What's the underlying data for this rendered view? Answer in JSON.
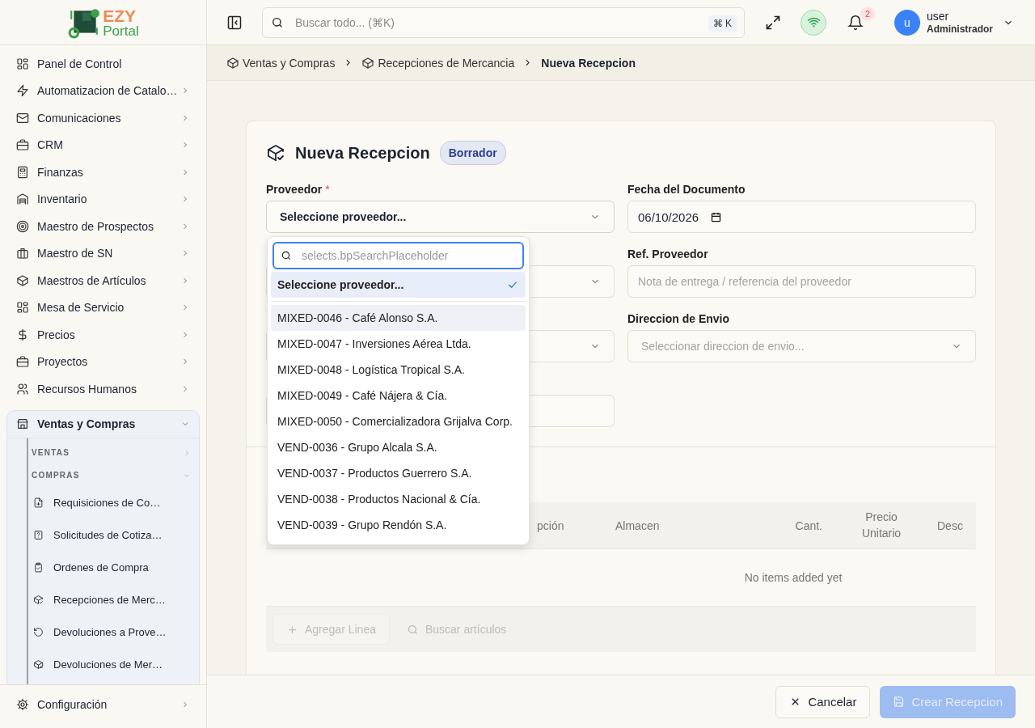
{
  "sidebar": {
    "logo": {
      "line_1": "EZY",
      "line_2": "Portal"
    },
    "items": [
      {
        "label": "Panel de Control",
        "expandable": false
      },
      {
        "label": "Automatizacion de Catalo…",
        "expandable": true,
        "expanded": false
      },
      {
        "label": "Comunicaciones",
        "expandable": true,
        "expanded": false
      },
      {
        "label": "CRM",
        "expandable": true,
        "expanded": false
      },
      {
        "label": "Finanzas",
        "expandable": true,
        "expanded": false
      },
      {
        "label": "Inventario",
        "expandable": true,
        "expanded": false
      },
      {
        "label": "Maestro de Prospectos",
        "expandable": true,
        "expanded": false
      },
      {
        "label": "Maestro de SN",
        "expandable": true,
        "expanded": false
      },
      {
        "label": "Maestros de Artículos",
        "expandable": true,
        "expanded": false
      },
      {
        "label": "Mesa de Servicio",
        "expandable": true,
        "expanded": false
      },
      {
        "label": "Precios",
        "expandable": true,
        "expanded": false
      },
      {
        "label": "Proyectos",
        "expandable": true,
        "expanded": false
      },
      {
        "label": "Recursos Humanos",
        "expandable": true,
        "expanded": false
      },
      {
        "label": "Ventas y Compras",
        "expandable": true,
        "expanded": true,
        "children": [
          {
            "label": "VENTAS",
            "expanded": false
          },
          {
            "label": "COMPRAS",
            "expanded": true,
            "children": [
              {
                "label": "Requisiciones de Co…"
              },
              {
                "label": "Solicitudes de Cotiza…"
              },
              {
                "label": "Ordenes de Compra"
              },
              {
                "label": "Recepciones de Merc…"
              },
              {
                "label": "Devoluciones a Prove…"
              },
              {
                "label": "Devoluciones de Mer…"
              }
            ]
          }
        ]
      }
    ],
    "footer_item": {
      "label": "Configuración"
    }
  },
  "header": {
    "search": {
      "placeholder": "Buscar todo... (⌘K)",
      "shortcut": "⌘ K"
    },
    "notifications": {
      "count": "2"
    },
    "user": {
      "avatar_letter": "u",
      "name": "user",
      "role": "Administrador"
    }
  },
  "breadcrumbs": [
    {
      "label": "Ventas y Compras",
      "current": false
    },
    {
      "label": "Recepciones de Mercancia",
      "current": false
    },
    {
      "label": "Nueva Recepcion",
      "current": true
    }
  ],
  "form": {
    "title": "Nueva Recepcion",
    "status": "Borrador",
    "fields": [
      {
        "kind": "select",
        "label": "Proveedor",
        "required_mark": "*",
        "value": "Seleccione proveedor...",
        "dropdown": {
          "search_placeholder": "selects.bpSearchPlaceholder",
          "options": [
            {
              "kind": "placeholder",
              "label": "Seleccione proveedor...",
              "selected": true,
              "highlighted": false
            },
            {
              "kind": "vendor",
              "label": "MIXED-0046 - Café Alonso S.A.",
              "selected": false,
              "highlighted": true
            },
            {
              "kind": "vendor",
              "label": "MIXED-0047 - Inversiones Aérea Ltda.",
              "selected": false,
              "highlighted": false
            },
            {
              "kind": "vendor",
              "label": "MIXED-0048 - Logística Tropical S.A.",
              "selected": false,
              "highlighted": false
            },
            {
              "kind": "vendor",
              "label": "MIXED-0049 - Café Nájera & Cía.",
              "selected": false,
              "highlighted": false
            },
            {
              "kind": "vendor",
              "label": "MIXED-0050 - Comercializadora Grijalva Corp.",
              "selected": false,
              "highlighted": false
            },
            {
              "kind": "vendor",
              "label": "VEND-0036 - Grupo Alcala S.A.",
              "selected": false,
              "highlighted": false
            },
            {
              "kind": "vendor",
              "label": "VEND-0037 - Productos Guerrero S.A.",
              "selected": false,
              "highlighted": false
            },
            {
              "kind": "vendor",
              "label": "VEND-0038 - Productos Nacional & Cía.",
              "selected": false,
              "highlighted": false
            },
            {
              "kind": "vendor",
              "label": "VEND-0039 - Grupo Rendón S.A.",
              "selected": false,
              "highlighted": false
            }
          ]
        }
      },
      {
        "kind": "date",
        "label": "Fecha del Documento",
        "value": "06/10/2026"
      },
      {
        "kind": "select"
      },
      {
        "kind": "text",
        "label": "Ref. Proveedor",
        "placeholder": "Nota de entrega / referencia del proveedor"
      },
      {
        "kind": "select"
      },
      {
        "kind": "select",
        "label": "Direccion de Envio",
        "placeholder": "Seleccionar direccion de envio..."
      },
      {
        "kind": "text"
      }
    ]
  },
  "lines": {
    "columns": [
      "pción",
      "Almacen",
      "Cant.",
      "Precio Unitario",
      "Desc"
    ],
    "empty_message": "No items added yet",
    "add_button": {
      "label": "Agregar Linea",
      "disabled": true
    },
    "search_button": {
      "label": "Buscar artículos",
      "disabled": true
    }
  },
  "footer": {
    "cancel": {
      "label": "Cancelar"
    },
    "submit": {
      "label": "Crear Recepcion",
      "disabled": true
    }
  }
}
